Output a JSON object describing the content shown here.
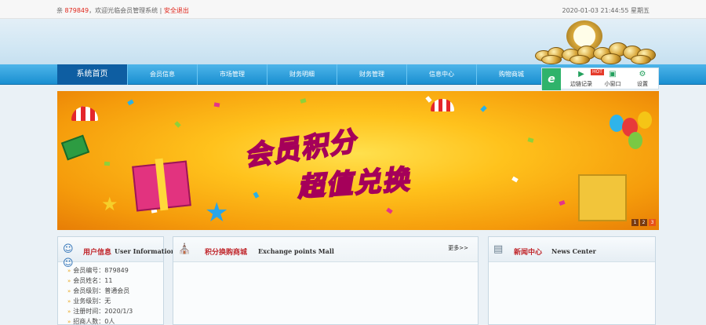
{
  "topbar": {
    "greeting_prefix": "亲",
    "user_id": "879849",
    "welcome_text": "，欢迎光临会员管理系统 |",
    "logout": "安全退出",
    "datetime": "2020-01-03 21:44:55 星期五"
  },
  "nav": {
    "home": "系统首页",
    "items": [
      "会员信息",
      "市场管理",
      "财务明细",
      "财务管理",
      "信息中心",
      "购物商城"
    ]
  },
  "quick": {
    "logo": "e",
    "hot_badge": "HOT",
    "items": [
      {
        "label": "边链记录",
        "icon": "video-icon"
      },
      {
        "label": "小窗口",
        "icon": "tv-icon"
      },
      {
        "label": "设置",
        "icon": "gear-icon"
      }
    ]
  },
  "banner": {
    "line1": "会员积分",
    "line2": "超值兑换",
    "pager": [
      "1",
      "2",
      "3"
    ],
    "active_page": 3
  },
  "user_panel": {
    "title_cn": "用户信息",
    "title_en": "User Information",
    "rows": [
      "会员编号：879849",
      "会员姓名：11",
      "会员级别：普通会员",
      "业务级别：无",
      "注册时间：2020/1/3",
      "招商人数：0人"
    ]
  },
  "mall_panel": {
    "title_cn": "积分换购商城",
    "title_en": "Exchange points Mall",
    "more": "更多>>"
  },
  "news_panel": {
    "title_cn": "新闻中心",
    "title_en": "News Center"
  },
  "colors": {
    "nav_blue": "#1a8fd1",
    "nav_active": "#0e5ea2",
    "accent_red": "#c0262b",
    "banner_orange": "#f59b0b"
  }
}
